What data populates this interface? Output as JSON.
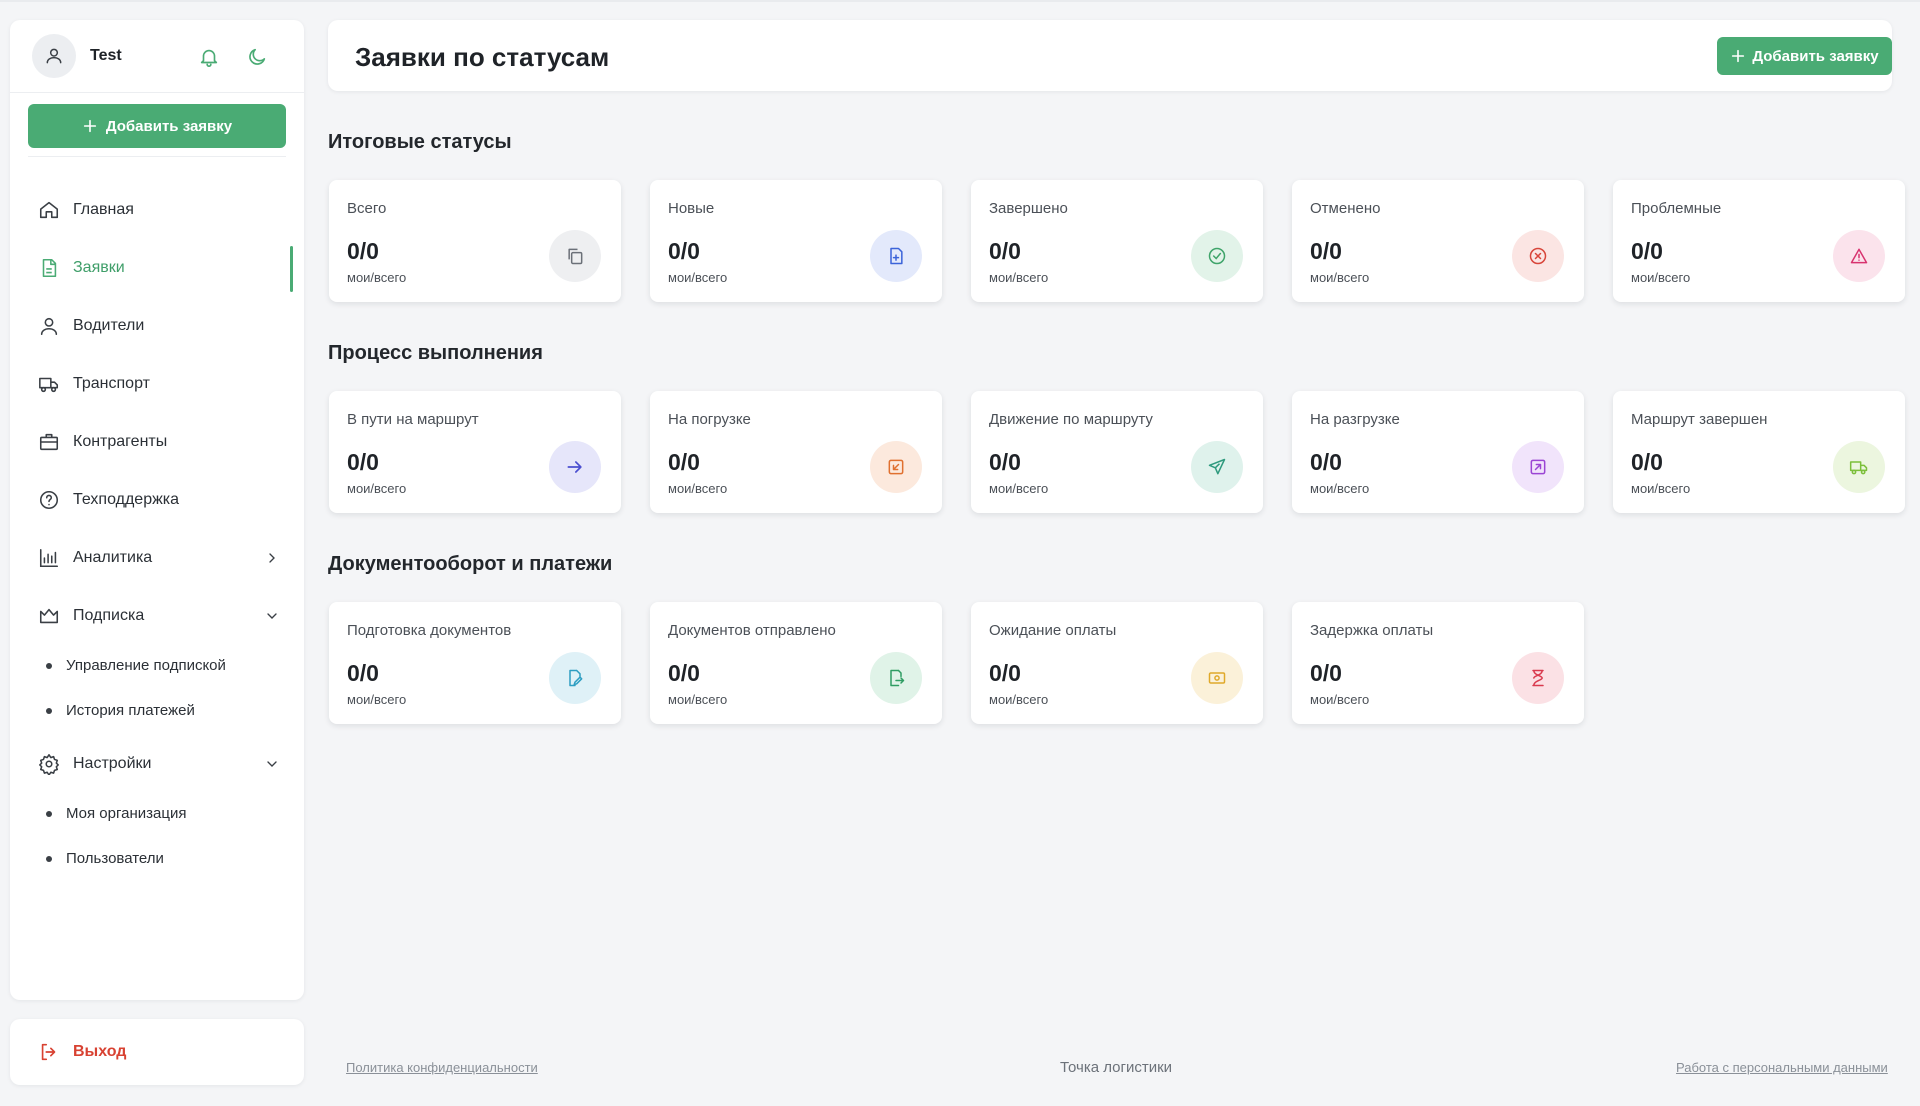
{
  "user": {
    "name": "Test"
  },
  "sidebar": {
    "add_button_label": "Добавить заявку",
    "items": [
      {
        "label": "Главная",
        "icon": "home-icon"
      },
      {
        "label": "Заявки",
        "icon": "document-icon",
        "active": true
      },
      {
        "label": "Водители",
        "icon": "user-icon"
      },
      {
        "label": "Транспорт",
        "icon": "truck-icon"
      },
      {
        "label": "Контрагенты",
        "icon": "briefcase-icon"
      },
      {
        "label": "Техподдержка",
        "icon": "help-icon"
      },
      {
        "label": "Аналитика",
        "icon": "bar-chart-icon"
      },
      {
        "label": "Подписка",
        "icon": "crown-icon"
      },
      {
        "label": "Настройки",
        "icon": "gear-icon"
      }
    ],
    "subscription_sub": [
      "Управление подпиской",
      "История платежей"
    ],
    "settings_sub": [
      "Моя организация",
      "Пользователи"
    ],
    "logout_label": "Выход"
  },
  "header": {
    "title": "Заявки по статусам",
    "add_button_label": "Добавить заявку"
  },
  "sections": [
    {
      "title": "Итоговые статусы",
      "cards": [
        {
          "title": "Всего",
          "value": "0/0",
          "sub": "мои/всего",
          "icon": "copy-icon",
          "color": "#6b7078",
          "bg": "#eeeff1"
        },
        {
          "title": "Новые",
          "value": "0/0",
          "sub": "мои/всего",
          "icon": "file-plus-icon",
          "color": "#3b63d9",
          "bg": "#e3e9fb"
        },
        {
          "title": "Завершено",
          "value": "0/0",
          "sub": "мои/всего",
          "icon": "check-circle-icon",
          "color": "#3fa46a",
          "bg": "#e2f3e9"
        },
        {
          "title": "Отменено",
          "value": "0/0",
          "sub": "мои/всего",
          "icon": "x-circle-icon",
          "color": "#d8453a",
          "bg": "#fbe5e3"
        },
        {
          "title": "Проблемные",
          "value": "0/0",
          "sub": "мои/всего",
          "icon": "alert-icon",
          "color": "#d8336f",
          "bg": "#fbe3ec"
        }
      ]
    },
    {
      "title": "Процесс выполнения",
      "cards": [
        {
          "title": "В пути на маршрут",
          "value": "0/0",
          "sub": "мои/всего",
          "icon": "arrow-right-icon",
          "color": "#4b4fd0",
          "bg": "#e6e6fa"
        },
        {
          "title": "На погрузке",
          "value": "0/0",
          "sub": "мои/всего",
          "icon": "load-icon",
          "color": "#e0702f",
          "bg": "#fce9dd"
        },
        {
          "title": "Движение по маршруту",
          "value": "0/0",
          "sub": "мои/всего",
          "icon": "send-icon",
          "color": "#2f9a7e",
          "bg": "#dff2ec"
        },
        {
          "title": "На разгрузке",
          "value": "0/0",
          "sub": "мои/всего",
          "icon": "unload-icon",
          "color": "#9b45d4",
          "bg": "#f1e4fb"
        },
        {
          "title": "Маршрут завершен",
          "value": "0/0",
          "sub": "мои/всего",
          "icon": "truck-icon",
          "color": "#7bbf3a",
          "bg": "#ecf6df"
        }
      ]
    },
    {
      "title": "Документооборот и платежи",
      "cards": [
        {
          "title": "Подготовка документов",
          "value": "0/0",
          "sub": "мои/всего",
          "icon": "edit-doc-icon",
          "color": "#2e9ec2",
          "bg": "#dff1f7"
        },
        {
          "title": "Документов отправлено",
          "value": "0/0",
          "sub": "мои/всего",
          "icon": "doc-send-icon",
          "color": "#2f9d63",
          "bg": "#e0f3e8"
        },
        {
          "title": "Ожидание оплаты",
          "value": "0/0",
          "sub": "мои/всего",
          "icon": "money-icon",
          "color": "#e0a92a",
          "bg": "#fbf1d9"
        },
        {
          "title": "Задержка оплаты",
          "value": "0/0",
          "sub": "мои/всего",
          "icon": "hourglass-icon",
          "color": "#d93a4e",
          "bg": "#fbe1e5"
        }
      ]
    }
  ],
  "footer": {
    "privacy": "Политика конфиденциальности",
    "brand": "Точка логистики",
    "personal_data": "Работа с персональными данными"
  }
}
